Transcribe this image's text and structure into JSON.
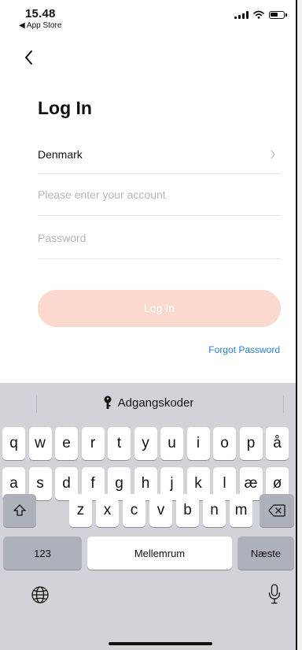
{
  "status_bar": {
    "time": "15.48",
    "back_app": "◀ App Store"
  },
  "page": {
    "title": "Log In",
    "country": "Denmark",
    "account_placeholder": "Please enter your account",
    "password_placeholder": "Password",
    "login_button": "Log In",
    "forgot_password": "Forgot Password"
  },
  "colors": {
    "login_button_bg": "#fcd9cf",
    "link": "#2a7de1"
  },
  "keyboard": {
    "suggestion": "Adgangskoder",
    "row1": [
      "q",
      "w",
      "e",
      "r",
      "t",
      "y",
      "u",
      "i",
      "o",
      "p",
      "å"
    ],
    "row2": [
      "a",
      "s",
      "d",
      "f",
      "g",
      "h",
      "j",
      "k",
      "l",
      "æ",
      "ø"
    ],
    "row3": [
      "z",
      "x",
      "c",
      "v",
      "b",
      "n",
      "m"
    ],
    "numbers_key": "123",
    "space_key": "Mellemrum",
    "next_key": "Næste"
  }
}
